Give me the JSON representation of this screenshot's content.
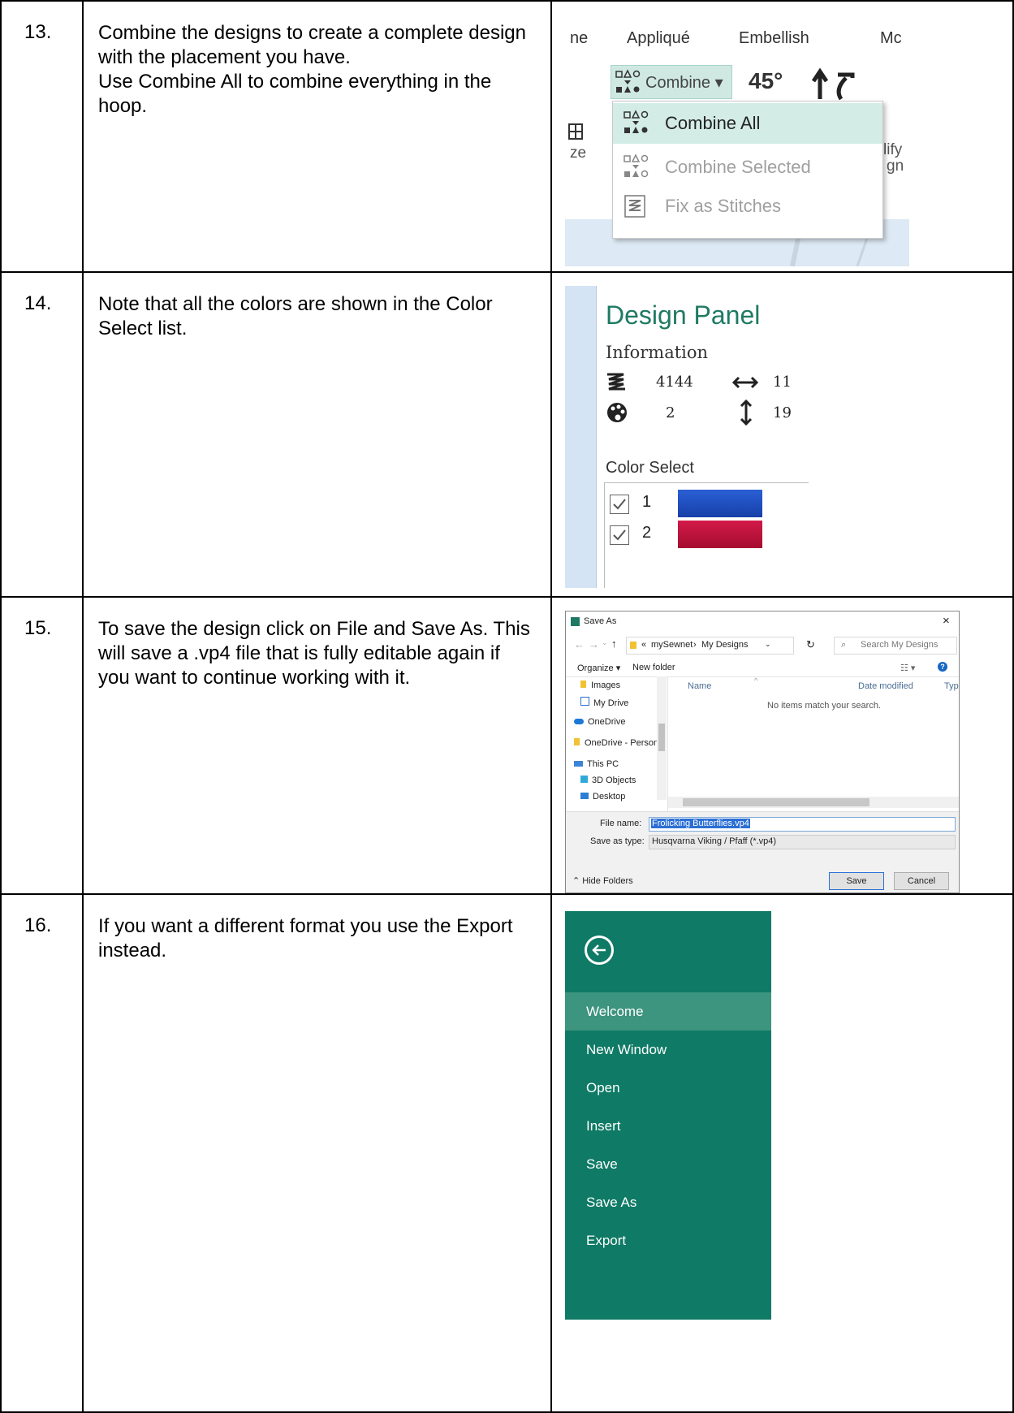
{
  "steps": [
    {
      "number": "13.",
      "lines": [
        "Combine the designs to create a complete design with the placement you have.",
        "Use Combine All to combine everything in the hoop."
      ]
    },
    {
      "number": "14.",
      "lines": [
        "Note that all the colors are shown in the Color Select list."
      ]
    },
    {
      "number": "15.",
      "lines": [
        "To save the design click on File and Save As. This will save a .vp4 file that is fully editable again if you want to continue working with it."
      ]
    },
    {
      "number": "16.",
      "lines": [
        "If you want a different format you use the Export instead."
      ]
    }
  ],
  "ribbon": {
    "tabs": [
      "ne",
      "Appliqué",
      "Embellish",
      "Mc"
    ],
    "combine_button": "Combine ▾",
    "rotate_angle": "45°",
    "side_left": "ze",
    "side_right_1": "lify",
    "side_right_2": "gn",
    "menu": {
      "combine_all": "Combine All",
      "combine_selected": "Combine Selected",
      "fix_as_stitches": "Fix as Stitches"
    },
    "colors": {
      "highlight": "#d4ece6",
      "button": "#cfe9e2"
    }
  },
  "design_panel": {
    "title": "Design Panel",
    "information_label": "Information",
    "stitch_count": "4144",
    "width_value": "11",
    "color_count": "2",
    "height_value": "19",
    "color_select_label": "Color Select",
    "colors": [
      {
        "index": "1",
        "hex": "#1f4fc4"
      },
      {
        "index": "2",
        "hex": "#c0143c"
      }
    ],
    "title_color": "#1f7a63"
  },
  "save_as": {
    "title": "Save As",
    "path_root": "«",
    "path_1": "mySewnet",
    "path_2": "My Designs",
    "search_placeholder": "Search My Designs",
    "organize": "Organize ▾",
    "new_folder": "New folder",
    "nav": [
      "Images",
      "My Drive",
      "OneDrive",
      "OneDrive - Person",
      "This PC",
      "3D Objects",
      "Desktop"
    ],
    "col_name": "Name",
    "col_date": "Date modified",
    "col_type": "Type",
    "empty_message": "No items match your search.",
    "file_name_label": "File name:",
    "file_name_value": "Frolicking Butterflies.vp4",
    "save_type_label": "Save as type:",
    "save_type_value": "Husqvarna Viking / Pfaff (*.vp4)",
    "hide_folders": "Hide Folders",
    "save_button": "Save",
    "cancel_button": "Cancel"
  },
  "backstage": {
    "items": [
      "Welcome",
      "New Window",
      "Open",
      "Insert",
      "Save",
      "Save As",
      "Export"
    ],
    "active": "Welcome",
    "background": "#0f7a65"
  }
}
